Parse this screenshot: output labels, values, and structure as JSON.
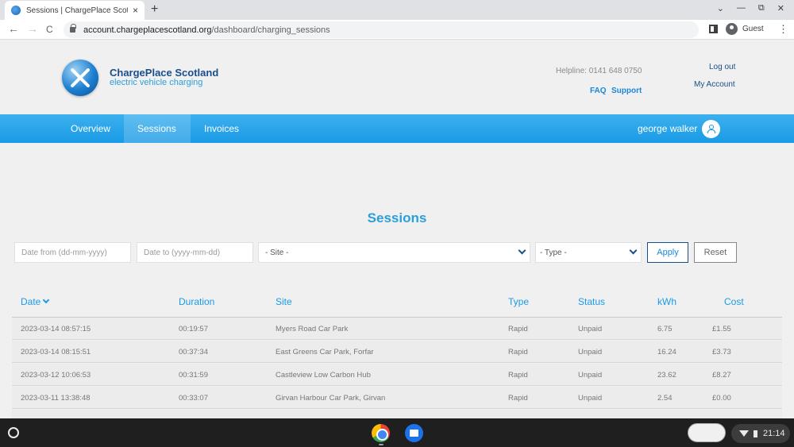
{
  "browser": {
    "tab_title": "Sessions | ChargePlace Scotland",
    "tab_close": "×",
    "new_tab": "+",
    "url_host": "account.chargeplacescotland.org",
    "url_path": "/dashboard/charging_sessions",
    "profile_label": "Guest",
    "back": "←",
    "forward": "→",
    "reload": "C",
    "menu": "⋮",
    "win_minimize": "—",
    "win_restore": "⧉",
    "win_close": "✕",
    "win_dropdown": "⌄"
  },
  "header": {
    "brand_name": "ChargePlace Scotland",
    "brand_tagline": "electric vehicle charging",
    "helpline": "Helpline: 0141 648 0750",
    "faq": "FAQ",
    "support": "Support",
    "logout": "Log out",
    "my_account": "My Account"
  },
  "nav": {
    "items": [
      {
        "label": "Overview",
        "active": false
      },
      {
        "label": "Sessions",
        "active": true
      },
      {
        "label": "Invoices",
        "active": false
      }
    ],
    "user_name": "george walker"
  },
  "main": {
    "heading": "Sessions",
    "filters": {
      "date_from_placeholder": "Date from (dd-mm-yyyy)",
      "date_to_placeholder": "Date to (yyyy-mm-dd)",
      "site_selected": "- Site -",
      "type_selected": "- Type -",
      "apply_label": "Apply",
      "reset_label": "Reset"
    },
    "table": {
      "columns": [
        "Date",
        "Duration",
        "Site",
        "Type",
        "Status",
        "kWh",
        "Cost"
      ],
      "rows": [
        [
          "2023-03-14 08:57:15",
          "00:19:57",
          "Myers Road Car Park",
          "Rapid",
          "Unpaid",
          "6.75",
          "£1.55"
        ],
        [
          "2023-03-14 08:15:51",
          "00:37:34",
          "East Greens Car Park, Forfar",
          "Rapid",
          "Unpaid",
          "16.24",
          "£3.73"
        ],
        [
          "2023-03-12 10:06:53",
          "00:31:59",
          "Castleview Low Carbon Hub",
          "Rapid",
          "Unpaid",
          "23.62",
          "£8.27"
        ],
        [
          "2023-03-11 13:38:48",
          "00:33:07",
          "Girvan Harbour Car Park, Girvan",
          "Rapid",
          "Unpaid",
          "2.54",
          "£0.00"
        ]
      ]
    }
  },
  "taskbar": {
    "clock": "21:14"
  },
  "colors": {
    "accent": "#1a9ae6",
    "brand_dark": "#1a4e8a",
    "navbar": "#1a9ae6"
  }
}
